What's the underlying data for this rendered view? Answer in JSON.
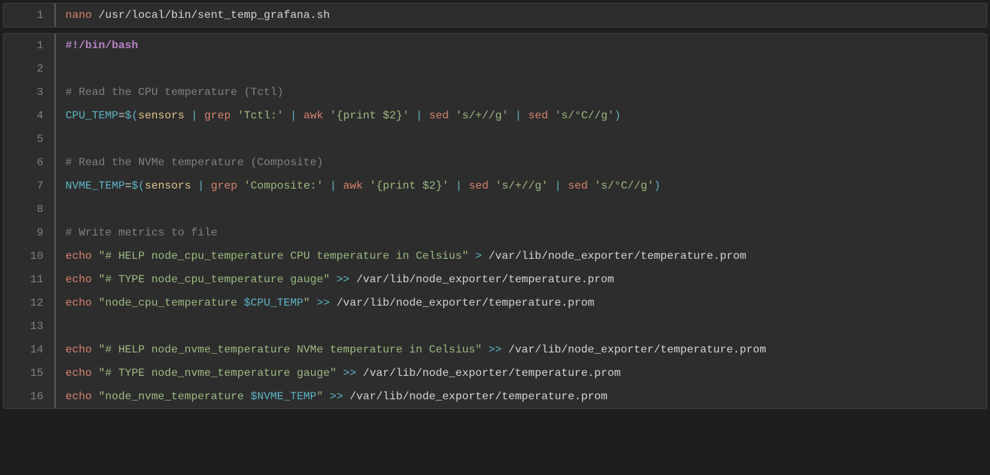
{
  "block1": {
    "lines": [
      {
        "n": "1",
        "tokens": [
          {
            "cls": "tok-cmd",
            "text": "nano"
          },
          {
            "cls": "tok-path",
            "text": " /usr/local/bin/sent_temp_grafana.sh"
          }
        ]
      }
    ]
  },
  "block2": {
    "lines": [
      {
        "n": "1",
        "tokens": [
          {
            "cls": "tok-shebang",
            "text": "#!/bin/bash"
          }
        ]
      },
      {
        "n": "2",
        "tokens": []
      },
      {
        "n": "3",
        "tokens": [
          {
            "cls": "tok-comment",
            "text": "# Read the CPU temperature (Tctl)"
          }
        ]
      },
      {
        "n": "4",
        "tokens": [
          {
            "cls": "tok-var",
            "text": "CPU_TEMP"
          },
          {
            "cls": "tok-op",
            "text": "="
          },
          {
            "cls": "tok-var",
            "text": "$("
          },
          {
            "cls": "tok-call",
            "text": "sensors"
          },
          {
            "cls": "tok-plain",
            "text": " "
          },
          {
            "cls": "tok-pipe",
            "text": "|"
          },
          {
            "cls": "tok-plain",
            "text": " "
          },
          {
            "cls": "tok-cmd",
            "text": "grep"
          },
          {
            "cls": "tok-plain",
            "text": " "
          },
          {
            "cls": "tok-str",
            "text": "'Tctl:'"
          },
          {
            "cls": "tok-plain",
            "text": " "
          },
          {
            "cls": "tok-pipe",
            "text": "|"
          },
          {
            "cls": "tok-plain",
            "text": " "
          },
          {
            "cls": "tok-cmd",
            "text": "awk"
          },
          {
            "cls": "tok-plain",
            "text": " "
          },
          {
            "cls": "tok-str",
            "text": "'{print $2}'"
          },
          {
            "cls": "tok-plain",
            "text": " "
          },
          {
            "cls": "tok-pipe",
            "text": "|"
          },
          {
            "cls": "tok-plain",
            "text": " "
          },
          {
            "cls": "tok-cmd",
            "text": "sed"
          },
          {
            "cls": "tok-plain",
            "text": " "
          },
          {
            "cls": "tok-str",
            "text": "'s/+//g'"
          },
          {
            "cls": "tok-plain",
            "text": " "
          },
          {
            "cls": "tok-pipe",
            "text": "|"
          },
          {
            "cls": "tok-plain",
            "text": " "
          },
          {
            "cls": "tok-cmd",
            "text": "sed"
          },
          {
            "cls": "tok-plain",
            "text": " "
          },
          {
            "cls": "tok-str",
            "text": "'s/°C//g'"
          },
          {
            "cls": "tok-var",
            "text": ")"
          }
        ]
      },
      {
        "n": "5",
        "tokens": []
      },
      {
        "n": "6",
        "tokens": [
          {
            "cls": "tok-comment",
            "text": "# Read the NVMe temperature (Composite)"
          }
        ]
      },
      {
        "n": "7",
        "tokens": [
          {
            "cls": "tok-var",
            "text": "NVME_TEMP"
          },
          {
            "cls": "tok-op",
            "text": "="
          },
          {
            "cls": "tok-var",
            "text": "$("
          },
          {
            "cls": "tok-call",
            "text": "sensors"
          },
          {
            "cls": "tok-plain",
            "text": " "
          },
          {
            "cls": "tok-pipe",
            "text": "|"
          },
          {
            "cls": "tok-plain",
            "text": " "
          },
          {
            "cls": "tok-cmd",
            "text": "grep"
          },
          {
            "cls": "tok-plain",
            "text": " "
          },
          {
            "cls": "tok-str",
            "text": "'Composite:'"
          },
          {
            "cls": "tok-plain",
            "text": " "
          },
          {
            "cls": "tok-pipe",
            "text": "|"
          },
          {
            "cls": "tok-plain",
            "text": " "
          },
          {
            "cls": "tok-cmd",
            "text": "awk"
          },
          {
            "cls": "tok-plain",
            "text": " "
          },
          {
            "cls": "tok-str",
            "text": "'{print $2}'"
          },
          {
            "cls": "tok-plain",
            "text": " "
          },
          {
            "cls": "tok-pipe",
            "text": "|"
          },
          {
            "cls": "tok-plain",
            "text": " "
          },
          {
            "cls": "tok-cmd",
            "text": "sed"
          },
          {
            "cls": "tok-plain",
            "text": " "
          },
          {
            "cls": "tok-str",
            "text": "'s/+//g'"
          },
          {
            "cls": "tok-plain",
            "text": " "
          },
          {
            "cls": "tok-pipe",
            "text": "|"
          },
          {
            "cls": "tok-plain",
            "text": " "
          },
          {
            "cls": "tok-cmd",
            "text": "sed"
          },
          {
            "cls": "tok-plain",
            "text": " "
          },
          {
            "cls": "tok-str",
            "text": "'s/°C//g'"
          },
          {
            "cls": "tok-var",
            "text": ")"
          }
        ]
      },
      {
        "n": "8",
        "tokens": []
      },
      {
        "n": "9",
        "tokens": [
          {
            "cls": "tok-comment",
            "text": "# Write metrics to file"
          }
        ]
      },
      {
        "n": "10",
        "tokens": [
          {
            "cls": "tok-cmd",
            "text": "echo"
          },
          {
            "cls": "tok-plain",
            "text": " "
          },
          {
            "cls": "tok-str",
            "text": "\"# HELP node_cpu_temperature CPU temperature in Celsius\""
          },
          {
            "cls": "tok-plain",
            "text": " "
          },
          {
            "cls": "tok-pipe",
            "text": ">"
          },
          {
            "cls": "tok-plain",
            "text": " "
          },
          {
            "cls": "tok-redirpth",
            "text": "/var/lib/node_exporter/temperature.prom"
          }
        ]
      },
      {
        "n": "11",
        "tokens": [
          {
            "cls": "tok-cmd",
            "text": "echo"
          },
          {
            "cls": "tok-plain",
            "text": " "
          },
          {
            "cls": "tok-str",
            "text": "\"# TYPE node_cpu_temperature gauge\""
          },
          {
            "cls": "tok-plain",
            "text": " "
          },
          {
            "cls": "tok-pipe",
            "text": ">>"
          },
          {
            "cls": "tok-plain",
            "text": " "
          },
          {
            "cls": "tok-redirpth",
            "text": "/var/lib/node_exporter/temperature.prom"
          }
        ]
      },
      {
        "n": "12",
        "tokens": [
          {
            "cls": "tok-cmd",
            "text": "echo"
          },
          {
            "cls": "tok-plain",
            "text": " "
          },
          {
            "cls": "tok-str",
            "text": "\"node_cpu_temperature "
          },
          {
            "cls": "tok-var",
            "text": "$CPU_TEMP"
          },
          {
            "cls": "tok-str",
            "text": "\""
          },
          {
            "cls": "tok-plain",
            "text": " "
          },
          {
            "cls": "tok-pipe",
            "text": ">>"
          },
          {
            "cls": "tok-plain",
            "text": " "
          },
          {
            "cls": "tok-redirpth",
            "text": "/var/lib/node_exporter/temperature.prom"
          }
        ]
      },
      {
        "n": "13",
        "tokens": []
      },
      {
        "n": "14",
        "tokens": [
          {
            "cls": "tok-cmd",
            "text": "echo"
          },
          {
            "cls": "tok-plain",
            "text": " "
          },
          {
            "cls": "tok-str",
            "text": "\"# HELP node_nvme_temperature NVMe temperature in Celsius\""
          },
          {
            "cls": "tok-plain",
            "text": " "
          },
          {
            "cls": "tok-pipe",
            "text": ">>"
          },
          {
            "cls": "tok-plain",
            "text": " "
          },
          {
            "cls": "tok-redirpth",
            "text": "/var/lib/node_exporter/temperature.prom"
          }
        ]
      },
      {
        "n": "15",
        "tokens": [
          {
            "cls": "tok-cmd",
            "text": "echo"
          },
          {
            "cls": "tok-plain",
            "text": " "
          },
          {
            "cls": "tok-str",
            "text": "\"# TYPE node_nvme_temperature gauge\""
          },
          {
            "cls": "tok-plain",
            "text": " "
          },
          {
            "cls": "tok-pipe",
            "text": ">>"
          },
          {
            "cls": "tok-plain",
            "text": " "
          },
          {
            "cls": "tok-redirpth",
            "text": "/var/lib/node_exporter/temperature.prom"
          }
        ]
      },
      {
        "n": "16",
        "tokens": [
          {
            "cls": "tok-cmd",
            "text": "echo"
          },
          {
            "cls": "tok-plain",
            "text": " "
          },
          {
            "cls": "tok-str",
            "text": "\"node_nvme_temperature "
          },
          {
            "cls": "tok-var",
            "text": "$NVME_TEMP"
          },
          {
            "cls": "tok-str",
            "text": "\""
          },
          {
            "cls": "tok-plain",
            "text": " "
          },
          {
            "cls": "tok-pipe",
            "text": ">>"
          },
          {
            "cls": "tok-plain",
            "text": " "
          },
          {
            "cls": "tok-redirpth",
            "text": "/var/lib/node_exporter/temperature.prom"
          }
        ]
      }
    ]
  }
}
